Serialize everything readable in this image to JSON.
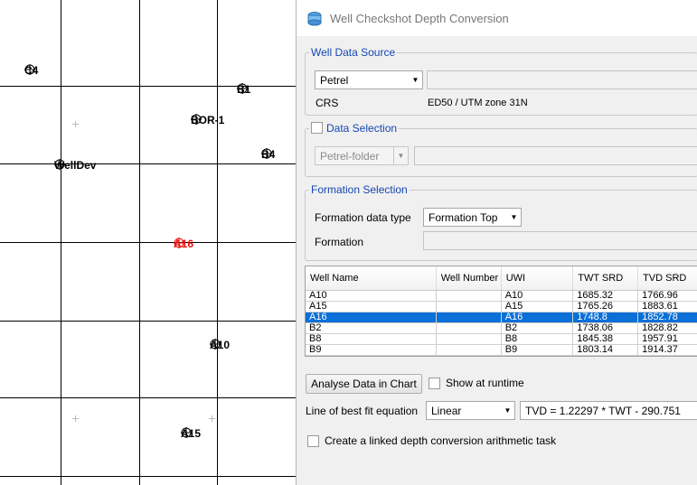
{
  "map": {
    "wells": [
      {
        "name": "C4",
        "color": "#000000"
      },
      {
        "name": "B1",
        "color": "#000000"
      },
      {
        "name": "BOR-1",
        "color": "#000000"
      },
      {
        "name": "B4",
        "color": "#000000"
      },
      {
        "name": "WellDev",
        "color": "#000000"
      },
      {
        "name": "A16",
        "color": "#e11111"
      },
      {
        "name": "A10",
        "color": "#000000"
      },
      {
        "name": "A15",
        "color": "#000000"
      }
    ]
  },
  "dialog": {
    "title": "Well Checkshot Depth Conversion",
    "well_data_source": {
      "legend": "Well Data Source",
      "source_value": "Petrel",
      "crs_label": "CRS",
      "crs_value": "ED50 / UTM zone 31N"
    },
    "data_selection": {
      "legend": "Data Selection",
      "checked": false,
      "folder_value": "Petrel-folder"
    },
    "formation_selection": {
      "legend": "Formation Selection",
      "type_label": "Formation data type",
      "type_value": "Formation Top",
      "formation_label": "Formation"
    },
    "table": {
      "columns": [
        "Well Name",
        "Well Number",
        "UWI",
        "TWT SRD",
        "TVD SRD"
      ],
      "rows": [
        [
          "A10",
          "",
          "A10",
          "1685.32",
          "1766.96"
        ],
        [
          "A15",
          "",
          "A15",
          "1765.26",
          "1883.61"
        ],
        [
          "A16",
          "",
          "A16",
          "1748.8",
          "1852.78"
        ],
        [
          "B2",
          "",
          "B2",
          "1738.06",
          "1828.82"
        ],
        [
          "B8",
          "",
          "B8",
          "1845.38",
          "1957.91"
        ],
        [
          "B9",
          "",
          "B9",
          "1803.14",
          "1914.37"
        ]
      ],
      "selected_row": "A16"
    },
    "analyse_button": "Analyse Data in Chart",
    "show_at_runtime": {
      "label": "Show at runtime",
      "checked": false
    },
    "best_fit": {
      "label": "Line of best fit equation",
      "type_value": "Linear",
      "equation": "TVD = 1.22297 * TWT - 290.751"
    },
    "linked_task": {
      "label": "Create a linked depth conversion arithmetic task",
      "checked": false
    },
    "colors": {
      "accent": "#1447b0",
      "selection": "#0a6fd6"
    }
  }
}
